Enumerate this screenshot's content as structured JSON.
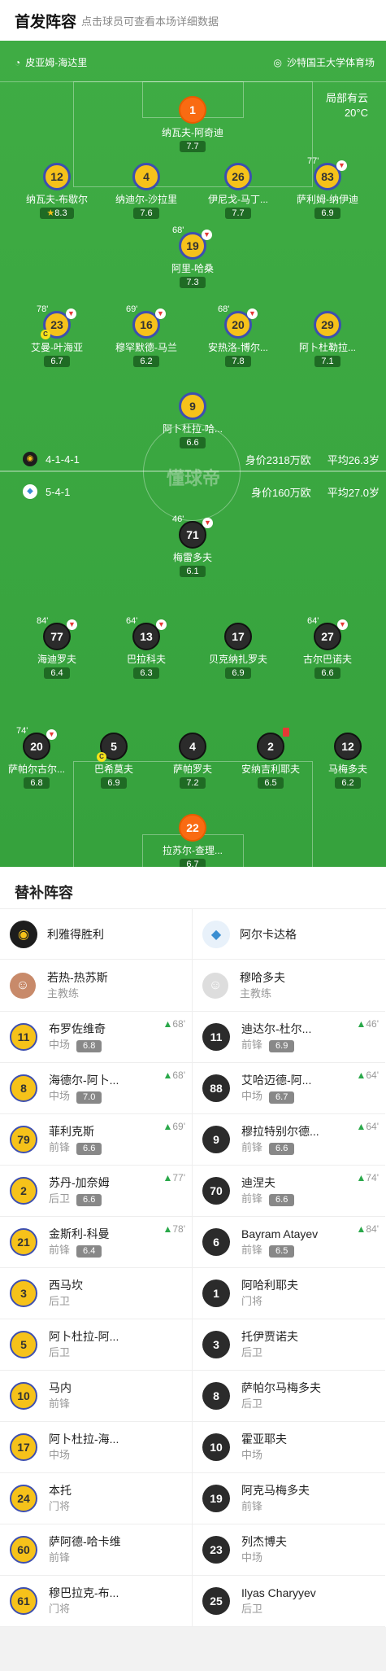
{
  "header": {
    "title": "首发阵容",
    "subtitle": "点击球员可查看本场详细数据"
  },
  "venue": {
    "referee": "皮亚姆-海达里",
    "stadium": "沙特国王大学体育场"
  },
  "weather": {
    "line1": "局部有云",
    "line2": "20°C"
  },
  "home_team": {
    "formation": "4-1-4-1",
    "value": "身价2318万欧",
    "avg_age": "平均26.3岁"
  },
  "away_team": {
    "formation": "5-4-1",
    "value": "身价160万欧",
    "avg_age": "平均27.0岁"
  },
  "watermark": "懂球帝",
  "home": [
    {
      "num": "1",
      "name": "纳瓦夫-阿奇迪",
      "rating": "7.7",
      "style": "o"
    },
    {
      "num": "12",
      "name": "纳瓦夫-布歇尔",
      "rating": "8.3",
      "style": "y",
      "star": "★"
    },
    {
      "num": "4",
      "name": "纳迪尔-沙拉里",
      "rating": "7.6",
      "style": "y"
    },
    {
      "num": "26",
      "name": "伊尼戈-马丁...",
      "rating": "7.7",
      "style": "y"
    },
    {
      "num": "83",
      "name": "萨利姆-纳伊迪",
      "rating": "6.9",
      "style": "y",
      "sub": "77'"
    },
    {
      "num": "19",
      "name": "阿里-哈桑",
      "rating": "7.3",
      "style": "y",
      "sub": "68'"
    },
    {
      "num": "23",
      "name": "艾曼-叶海亚",
      "rating": "6.7",
      "style": "y",
      "sub": "78'",
      "card": "C"
    },
    {
      "num": "16",
      "name": "穆罕默德-马兰",
      "rating": "6.2",
      "style": "y",
      "sub": "69'"
    },
    {
      "num": "20",
      "name": "安热洛-博尔...",
      "rating": "7.8",
      "style": "y",
      "sub": "68'"
    },
    {
      "num": "29",
      "name": "阿卜杜勒拉...",
      "rating": "7.1",
      "style": "y"
    },
    {
      "num": "9",
      "name": "阿卜杜拉-哈...",
      "rating": "6.6",
      "style": "y"
    }
  ],
  "away": [
    {
      "num": "71",
      "name": "梅雷多夫",
      "rating": "6.1",
      "style": "k",
      "sub": "46'"
    },
    {
      "num": "77",
      "name": "海迪罗夫",
      "rating": "6.4",
      "style": "k",
      "sub": "84'"
    },
    {
      "num": "13",
      "name": "巴拉科夫",
      "rating": "6.3",
      "style": "k",
      "sub": "64'"
    },
    {
      "num": "17",
      "name": "贝克纳扎罗夫",
      "rating": "6.9",
      "style": "k"
    },
    {
      "num": "27",
      "name": "古尔巴诺夫",
      "rating": "6.6",
      "style": "k",
      "sub": "64'"
    },
    {
      "num": "20",
      "name": "萨帕尔古尔...",
      "rating": "6.8",
      "style": "k",
      "sub": "74'"
    },
    {
      "num": "5",
      "name": "巴希莫夫",
      "rating": "6.9",
      "style": "k",
      "card": "C"
    },
    {
      "num": "4",
      "name": "萨帕罗夫",
      "rating": "7.2",
      "style": "k"
    },
    {
      "num": "2",
      "name": "安纳吉利耶夫",
      "rating": "6.5",
      "style": "k",
      "red": true
    },
    {
      "num": "12",
      "name": "马梅多夫",
      "rating": "6.2",
      "style": "k"
    },
    {
      "num": "22",
      "name": "拉苏尔-查理...",
      "rating": "6.7",
      "style": "o"
    }
  ],
  "subs_title": "替补阵容",
  "subs_home": {
    "team": "利雅得胜利",
    "coach": "若热-热苏斯",
    "coach_role": "主教练",
    "players": [
      {
        "num": "11",
        "name": "布罗佐维奇",
        "pos": "中场",
        "rating": "6.8",
        "time": "68'"
      },
      {
        "num": "8",
        "name": "海德尔-阿卜...",
        "pos": "中场",
        "rating": "7.0",
        "time": "68'"
      },
      {
        "num": "79",
        "name": "菲利克斯",
        "pos": "前锋",
        "rating": "6.6",
        "time": "69'"
      },
      {
        "num": "2",
        "name": "苏丹-加奈姆",
        "pos": "后卫",
        "rating": "6.6",
        "time": "77'"
      },
      {
        "num": "21",
        "name": "金斯利-科曼",
        "pos": "前锋",
        "rating": "6.4",
        "time": "78'"
      },
      {
        "num": "3",
        "name": "西马坎",
        "pos": "后卫"
      },
      {
        "num": "5",
        "name": "阿卜杜拉-阿...",
        "pos": "后卫"
      },
      {
        "num": "10",
        "name": "马内",
        "pos": "前锋"
      },
      {
        "num": "17",
        "name": "阿卜杜拉-海...",
        "pos": "中场"
      },
      {
        "num": "24",
        "name": "本托",
        "pos": "门将"
      },
      {
        "num": "60",
        "name": "萨阿德-哈卡维",
        "pos": "前锋"
      },
      {
        "num": "61",
        "name": "穆巴拉克-布...",
        "pos": "门将"
      }
    ]
  },
  "subs_away": {
    "team": "阿尔卡达格",
    "coach": "穆哈多夫",
    "coach_role": "主教练",
    "players": [
      {
        "num": "11",
        "name": "迪达尔-杜尔...",
        "pos": "前锋",
        "rating": "6.9",
        "time": "46'"
      },
      {
        "num": "88",
        "name": "艾哈迈德-阿...",
        "pos": "中场",
        "rating": "6.7",
        "time": "64'"
      },
      {
        "num": "9",
        "name": "穆拉特别尔德...",
        "pos": "前锋",
        "rating": "6.6",
        "time": "64'"
      },
      {
        "num": "70",
        "name": "迪涅夫",
        "pos": "前锋",
        "rating": "6.6",
        "time": "74'"
      },
      {
        "num": "6",
        "name": "Bayram Atayev",
        "pos": "前锋",
        "rating": "6.5",
        "time": "84'"
      },
      {
        "num": "1",
        "name": "阿哈利耶夫",
        "pos": "门将"
      },
      {
        "num": "3",
        "name": "托伊贾诺夫",
        "pos": "后卫"
      },
      {
        "num": "8",
        "name": "萨帕尔马梅多夫",
        "pos": "后卫"
      },
      {
        "num": "10",
        "name": "霍亚耶夫",
        "pos": "中场"
      },
      {
        "num": "19",
        "name": "阿克马梅多夫",
        "pos": "前锋"
      },
      {
        "num": "23",
        "name": "列杰博夫",
        "pos": "中场"
      },
      {
        "num": "25",
        "name": "Ilyas Charyyev",
        "pos": "后卫"
      }
    ]
  }
}
